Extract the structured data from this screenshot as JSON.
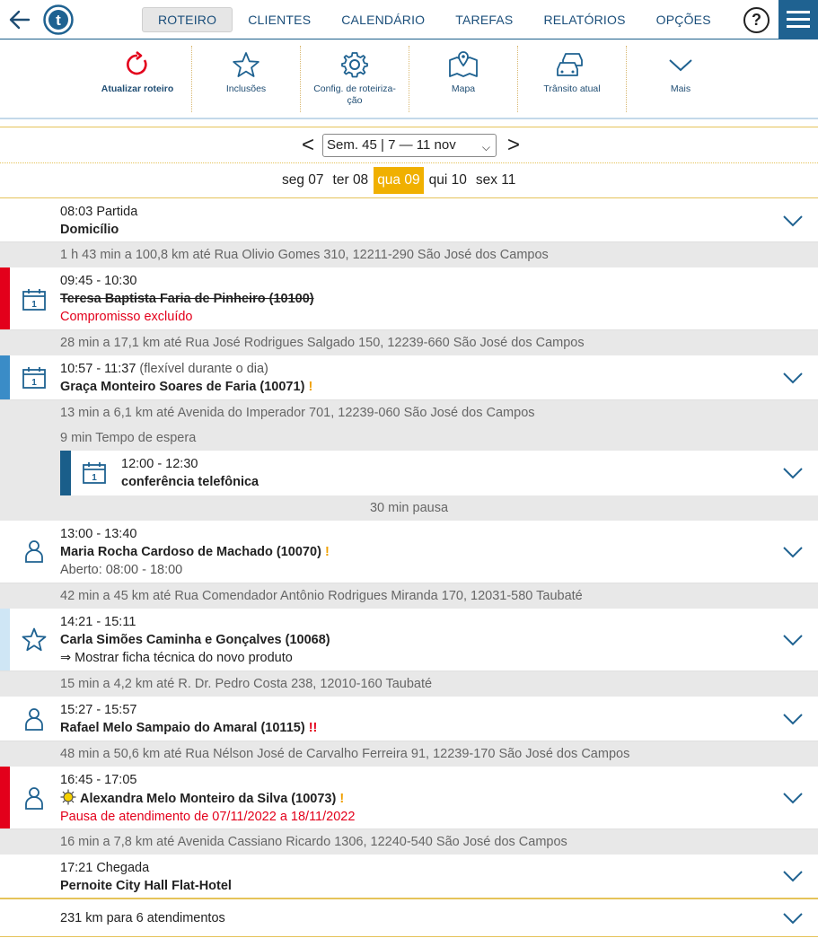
{
  "nav": {
    "tabs": [
      "ROTEIRO",
      "CLIENTES",
      "CALENDÁRIO",
      "TAREFAS",
      "RELATÓRIOS",
      "OPÇÕES"
    ],
    "help": "?"
  },
  "toolbar": {
    "update": "Atualizar roteiro",
    "inclusions": "Inclusões",
    "config": "Config. de roteiriza-ção",
    "map": "Mapa",
    "traffic": "Trânsito atual",
    "more": "Mais"
  },
  "week": {
    "prev": "<",
    "next": ">",
    "selected": "Sem. 45 | 7 — 11 nov"
  },
  "days": [
    "seg 07",
    "ter 08",
    "qua 09",
    "qui 10",
    "sex 11"
  ],
  "colors": {
    "accent": "#1f6291",
    "active_day": "#f0b000",
    "red": "#e3001b",
    "blue_stripe": "#3a8cc7",
    "light_blue_stripe": "#cfe6f5",
    "dark_blue_stripe": "#1a5e8a"
  },
  "route": {
    "start_time": "08:03 Partida",
    "start_place": "Domicílio",
    "gap1": "1 h 43 min a 100,8 km até Rua Olivio Gomes 310, 12211-290 São José dos Campos",
    "a1_time": "09:45 - 10:30",
    "a1_name": "Teresa Baptista Faria de Pinheiro (10100)",
    "a1_status": "Compromisso excluído",
    "gap2": "28 min a 17,1 km até Rua José Rodrigues Salgado 150, 12239-660 São José dos Campos",
    "a2_time": "10:57 - 11:37",
    "a2_note": "(flexível durante o dia)",
    "a2_name": "Graça Monteiro Soares de Faria (10071)",
    "a2_flag": "!",
    "gap3": "13 min a 6,1 km até Avenida do Imperador 701, 12239-060 São José dos Campos",
    "wait": "9 min Tempo de espera",
    "a3_time": "12:00 - 12:30",
    "a3_name": "conferência telefônica",
    "pause": "30 min pausa",
    "a4_time": "13:00 - 13:40",
    "a4_name": "Maria Rocha Cardoso de Machado (10070)",
    "a4_flag": "!",
    "a4_open": "Aberto: 08:00 - 18:00",
    "gap4": "42 min a 45 km até Rua Comendador Antônio Rodrigues Miranda 170, 12031-580 Taubaté",
    "a5_time": "14:21 - 15:11",
    "a5_name": "Carla Simões Caminha e Gonçalves (10068)",
    "a5_note": "⇒ Mostrar ficha técnica do novo produto",
    "gap5": "15 min a 4,2 km até R. Dr. Pedro Costa 238, 12010-160 Taubaté",
    "a6_time": "15:27 - 15:57",
    "a6_name": "Rafael Melo Sampaio do Amaral (10115)",
    "a6_flag": "!!",
    "gap6": "48 min a 50,6 km até Rua Nélson José de Carvalho Ferreira 91, 12239-170 São José dos Campos",
    "a7_time": "16:45 - 17:05",
    "a7_name": "Alexandra Melo Monteiro da Silva (10073)",
    "a7_flag": "!",
    "a7_status": "Pausa de atendimento de 07/11/2022 a 18/11/2022",
    "gap7": "16 min a 7,8 km até Avenida Cassiano Ricardo 1306, 12240-540 São José dos Campos",
    "end_time": "17:21 Chegada",
    "end_place": "Pernoite City Hall Flat-Hotel",
    "summary": "231 km para 6 atendimentos"
  }
}
